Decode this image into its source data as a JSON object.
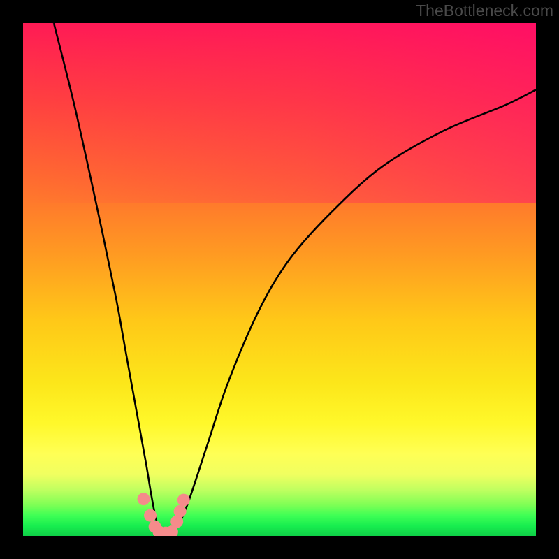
{
  "watermark": "TheBottleneck.com",
  "colors": {
    "curve_stroke": "#000000",
    "marker_fill": "#f58b8b",
    "frame_bg": "#000000"
  },
  "chart_data": {
    "type": "line",
    "title": "",
    "xlabel": "",
    "ylabel": "",
    "xlim": [
      0,
      100
    ],
    "ylim": [
      0,
      100
    ],
    "grid": false,
    "legend": false,
    "series": [
      {
        "name": "bottleneck-curve",
        "x": [
          6,
          10,
          14,
          18,
          20,
          22,
          24,
          25,
          26,
          27,
          28,
          30,
          32,
          36,
          40,
          46,
          52,
          60,
          70,
          82,
          94,
          100
        ],
        "values": [
          100,
          84,
          66,
          47,
          36,
          25,
          14,
          8,
          3,
          1,
          1,
          2,
          6,
          18,
          30,
          44,
          54,
          63,
          72,
          79,
          84,
          87
        ]
      }
    ],
    "markers": {
      "name": "marker-points",
      "x": [
        23.5,
        24.8,
        25.7,
        26.5,
        27.8,
        29.0,
        30.0,
        30.6,
        31.3
      ],
      "values": [
        7.2,
        4.0,
        1.8,
        0.8,
        0.6,
        0.8,
        2.8,
        4.8,
        7.0
      ]
    }
  }
}
